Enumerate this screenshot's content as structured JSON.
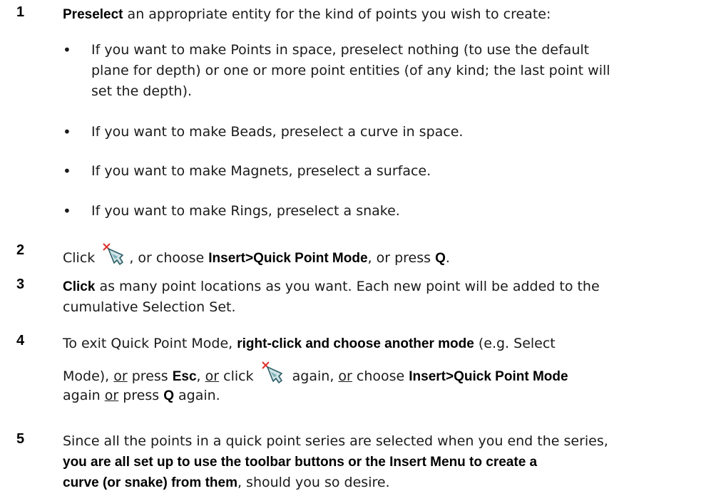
{
  "steps": [
    {
      "num": "1",
      "bold": "Preselect",
      "text": " an appropriate entity for the kind of points you wish to create:",
      "bullets": [
        {
          "dot": "•",
          "lines": [
            "If you want to make Points in space, preselect nothing (to use the default",
            "plane for depth) or one or more point entities (of any kind; the last point will",
            "set the depth)."
          ]
        },
        {
          "dot": "•",
          "lines": [
            "If you want to make Beads, preselect a curve in space."
          ]
        },
        {
          "dot": "•",
          "lines": [
            "If you want to make Magnets, preselect a surface."
          ]
        },
        {
          "dot": "•",
          "lines": [
            "If you want to make Rings, preselect a snake."
          ]
        }
      ]
    },
    {
      "num": "2",
      "t1": "Click ",
      "t2": ", or choose ",
      "b1": "Insert>Quick Point Mode",
      "t3": ", or press ",
      "b2": "Q",
      "t4": "."
    },
    {
      "num": "3",
      "b1": "Click",
      "t1": " as many point locations as you want. Each new point will be added to the",
      "t2": "cumulative Selection Set."
    },
    {
      "num": "4",
      "t1": "To exit Quick Point Mode, ",
      "b1": "right-click and choose another mode",
      "t2": " (e.g. Select",
      "t3": "Mode), ",
      "u1": "or",
      "t4": " press ",
      "b2": "Esc",
      "t5": ", ",
      "u2": "or",
      "t6": " click ",
      "t7": " again, ",
      "u3": "or",
      "t8": " choose ",
      "b3": "Insert>Quick Point Mode",
      "t9": "again ",
      "u4": "or",
      "t10": " press ",
      "b4": "Q",
      "t11": " again."
    },
    {
      "num": "5",
      "t1": "Since all the points in a quick point series are selected when you end the series,",
      "b1": "you are all set up to use the toolbar buttons or the Insert Menu to create a",
      "b2": "curve (or snake) from them",
      "t2": ", should you so desire."
    }
  ],
  "icons": {
    "quick_point": "quick-point-mode-icon"
  }
}
